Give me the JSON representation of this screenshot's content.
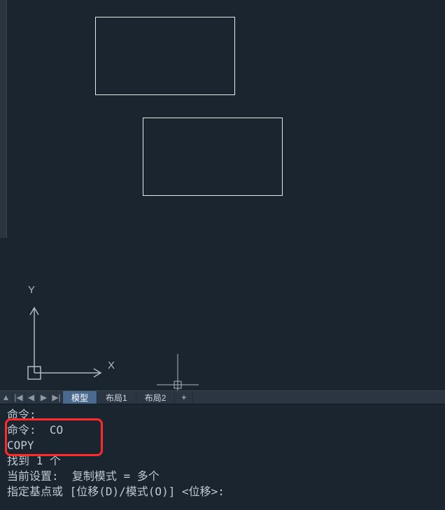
{
  "ucs": {
    "x_label": "X",
    "y_label": "Y"
  },
  "tabbar": {
    "nav": {
      "up": "▲",
      "first": "|◀",
      "prev": "◀",
      "next": "▶",
      "last": "▶|"
    },
    "tabs": [
      {
        "label": "模型",
        "active": true
      },
      {
        "label": "布局1",
        "active": false
      },
      {
        "label": "布局2",
        "active": false
      }
    ],
    "add": "+"
  },
  "cmdlog": {
    "lines": [
      "命令:",
      "命令:  CO",
      "COPY",
      "找到 1 个",
      "当前设置:  复制模式 = 多个",
      "指定基点或 [位移(D)/模式(O)] <位移>:"
    ]
  }
}
